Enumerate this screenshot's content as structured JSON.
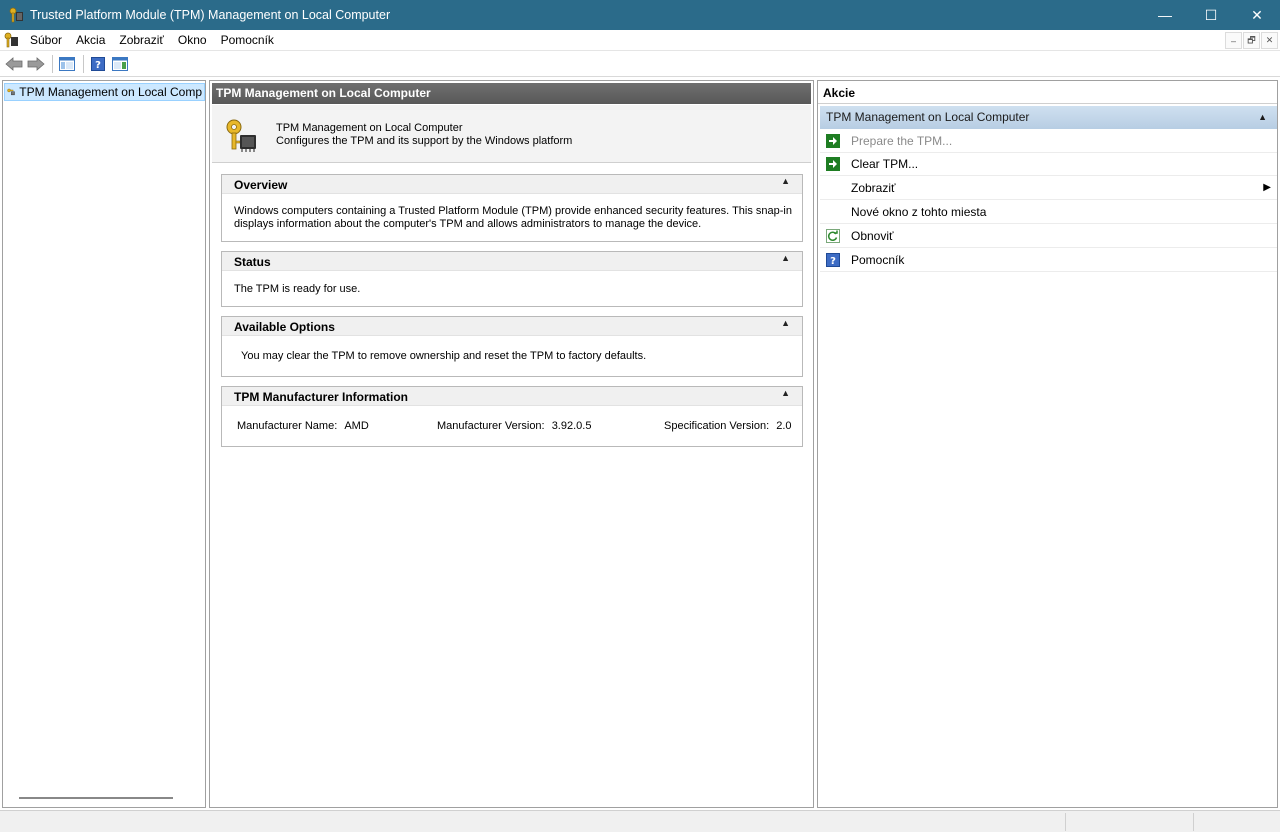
{
  "window": {
    "title": "Trusted Platform Module (TPM) Management on Local Computer",
    "controls": {
      "minimize": "—",
      "maximize": "☐",
      "close": "✕"
    }
  },
  "menu": {
    "items": [
      "Súbor",
      "Akcia",
      "Zobraziť",
      "Okno",
      "Pomocník"
    ],
    "mdi": {
      "minimize": "–",
      "restore": "🗗",
      "close": "✕"
    }
  },
  "tree": {
    "root_label": "TPM Management on Local Comp"
  },
  "center": {
    "header": "TPM Management on Local Computer",
    "intro": {
      "title": "TPM Management on Local Computer",
      "description": "Configures the TPM and its support by the Windows platform"
    },
    "sections": {
      "overview": {
        "title": "Overview",
        "toggle": "▲",
        "line1": "Windows computers containing a Trusted Platform Module (TPM) provide enhanced security features. This snap-in",
        "line2": "displays information about the computer's TPM and allows administrators to manage the device."
      },
      "status": {
        "title": "Status",
        "toggle": "▲",
        "text": "The TPM is ready for use."
      },
      "options": {
        "title": "Available Options",
        "toggle": "▲",
        "text": "You may clear the TPM to remove ownership and reset the TPM to factory defaults."
      },
      "manufacturer": {
        "title": "TPM Manufacturer Information",
        "toggle": "▲",
        "name_label": "Manufacturer Name:",
        "name_value": "AMD",
        "version_label": "Manufacturer Version:",
        "version_value": "3.92.0.5",
        "spec_label": "Specification Version:",
        "spec_value": "2.0"
      }
    }
  },
  "actions": {
    "header": "Akcie",
    "group_title": "TPM Management on Local Computer",
    "group_toggle": "▲",
    "items": [
      {
        "label": "Prepare the TPM...",
        "icon": "green-arrow-icon",
        "disabled": true
      },
      {
        "label": "Clear TPM...",
        "icon": "green-arrow-icon",
        "disabled": false
      },
      {
        "label": "Zobraziť",
        "icon": "",
        "submenu": "▶"
      },
      {
        "label": "Nové okno z tohto miesta",
        "icon": ""
      },
      {
        "label": "Obnoviť",
        "icon": "refresh-icon"
      },
      {
        "label": "Pomocník",
        "icon": "help-icon"
      }
    ]
  },
  "colors": {
    "titlebar": "#2b6b8a",
    "center_header": "#606060",
    "actions_group": "#c3d6ea",
    "green_action": "#1e7d22",
    "help_blue": "#3d6cc4"
  }
}
